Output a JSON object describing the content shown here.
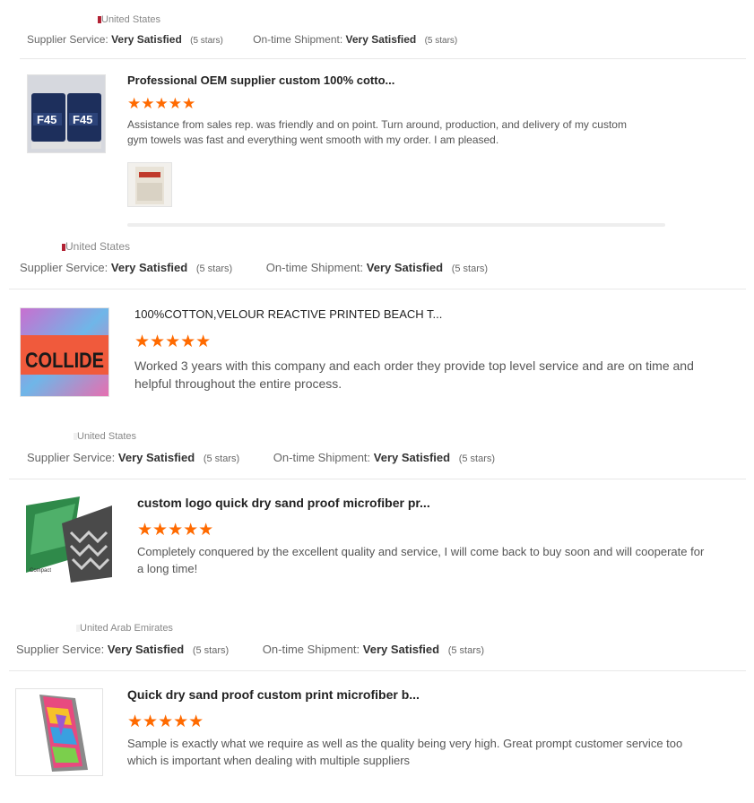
{
  "reviews": [
    {
      "country": "United States",
      "service_label": "Supplier Service:",
      "service_value": "Very Satisfied",
      "service_stars": "(5 stars)",
      "shipment_label": "On-time Shipment:",
      "shipment_value": "Very Satisfied",
      "shipment_stars": "(5 stars)",
      "product_title": "Professional OEM supplier custom 100% cotto...",
      "rating": "★★★★★",
      "review_text": "Assistance from sales rep. was friendly and on point. Turn around, production, and delivery of my custom gym towels was fast and everything went smooth with my order. I am pleased.",
      "thumb_text": "F45"
    },
    {
      "country": "United States",
      "service_label": "Supplier Service:",
      "service_value": "Very Satisfied",
      "service_stars": "(5 stars)",
      "shipment_label": "On-time Shipment:",
      "shipment_value": "Very Satisfied",
      "shipment_stars": "(5 stars)",
      "product_title": "100%COTTON,VELOUR REACTIVE PRINTED BEACH T...",
      "rating": "★★★★★",
      "review_text": "Worked 3 years with this company and each order they provide top level service and are on time and helpful throughout the entire process.",
      "thumb_text": "COLLIDE"
    },
    {
      "country": "United States",
      "service_label": "Supplier Service:",
      "service_value": "Very Satisfied",
      "service_stars": "(5 stars)",
      "shipment_label": "On-time Shipment:",
      "shipment_value": "Very Satisfied",
      "shipment_stars": "(5 stars)",
      "product_title": "custom logo quick dry sand proof microfiber pr...",
      "rating": "★★★★★",
      "review_text": "Completely conquered by the excellent quality and service, I will come back to buy soon and will cooperate for a long time!",
      "thumb_text": "Compact"
    },
    {
      "country": "United Arab Emirates",
      "service_label": "Supplier Service:",
      "service_value": "Very Satisfied",
      "service_stars": "(5 stars)",
      "shipment_label": "On-time Shipment:",
      "shipment_value": "Very Satisfied",
      "shipment_stars": "(5 stars)",
      "product_title": "Quick dry sand proof custom print microfiber b...",
      "rating": "★★★★★",
      "review_text": "Sample is exactly what we require as well as the quality being very high. Great prompt customer service too which is important when dealing with multiple suppliers"
    }
  ]
}
